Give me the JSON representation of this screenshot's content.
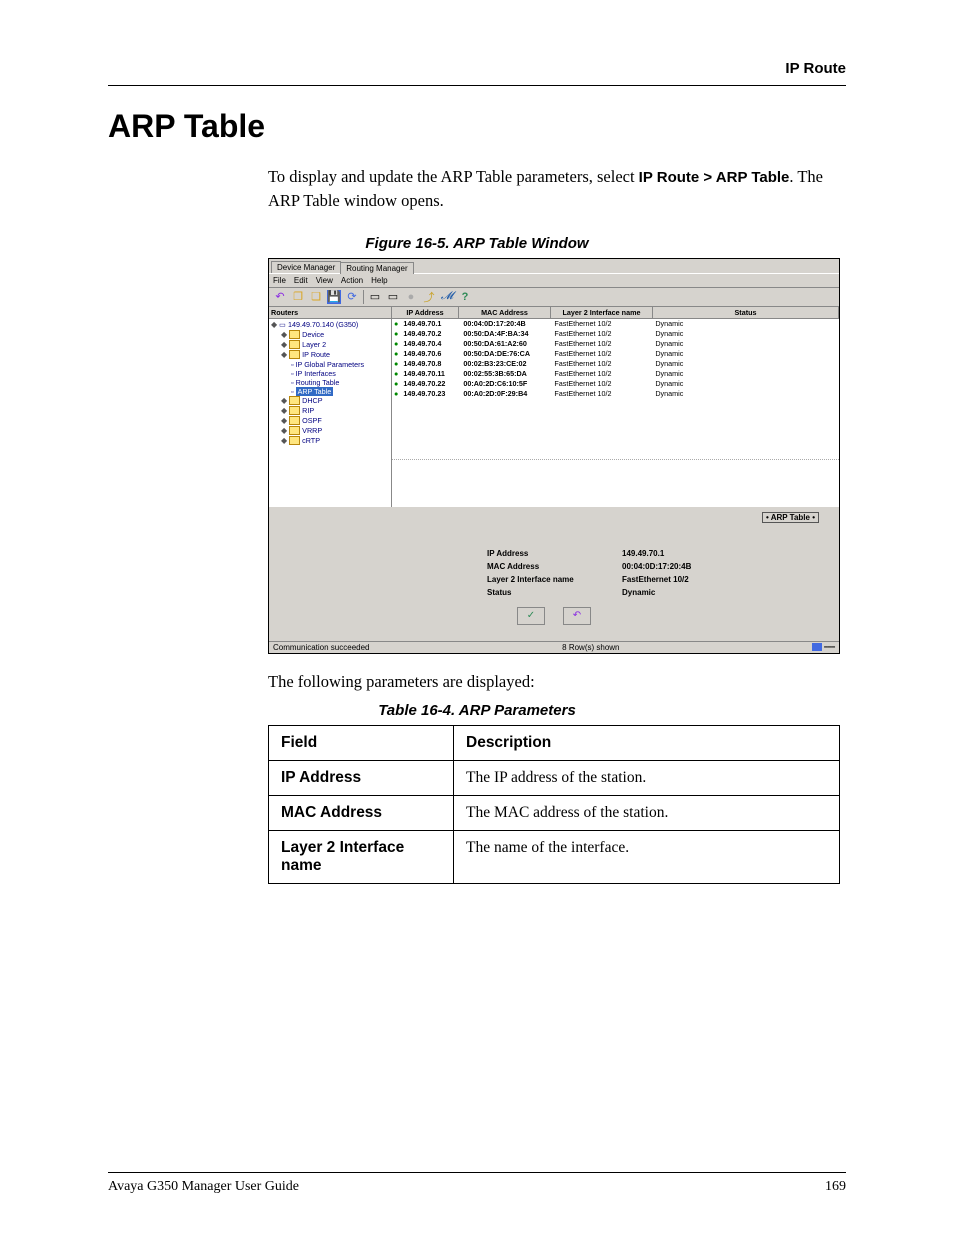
{
  "header": {
    "section": "IP Route"
  },
  "title": "ARP Table",
  "intro": {
    "prefix": "To display and update the ARP Table parameters, select ",
    "bold": "IP Route > ARP Table",
    "suffix": ". The ARP Table window opens."
  },
  "figure_caption": "Figure 16-5.  ARP Table Window",
  "screenshot": {
    "tabs": [
      "Device Manager",
      "Routing Manager"
    ],
    "menu": [
      "File",
      "Edit",
      "View",
      "Action",
      "Help"
    ],
    "tree_title": "Routers",
    "tree": {
      "root": "149.49.70.140 (G350)",
      "nodes": [
        "Device",
        "Layer 2",
        "IP Route"
      ],
      "iproute_children": [
        "IP Global Parameters",
        "IP Interfaces",
        "Routing Table",
        "ARP Table"
      ],
      "after": [
        "DHCP",
        "RIP",
        "OSPF",
        "VRRP",
        "cRTP"
      ]
    },
    "columns": [
      "IP Address",
      "MAC Address",
      "Layer 2 Interface name",
      "Status"
    ],
    "rows": [
      {
        "ip": "149.49.70.1",
        "mac": "00:04:0D:17:20:4B",
        "l2": "FastEthernet 10/2",
        "st": "Dynamic"
      },
      {
        "ip": "149.49.70.2",
        "mac": "00:50:DA:4F:BA:34",
        "l2": "FastEthernet 10/2",
        "st": "Dynamic"
      },
      {
        "ip": "149.49.70.4",
        "mac": "00:50:DA:61:A2:60",
        "l2": "FastEthernet 10/2",
        "st": "Dynamic"
      },
      {
        "ip": "149.49.70.6",
        "mac": "00:50:DA:DE:76:CA",
        "l2": "FastEthernet 10/2",
        "st": "Dynamic"
      },
      {
        "ip": "149.49.70.8",
        "mac": "00:02:B3:23:CE:02",
        "l2": "FastEthernet 10/2",
        "st": "Dynamic"
      },
      {
        "ip": "149.49.70.11",
        "mac": "00:02:55:3B:65:DA",
        "l2": "FastEthernet 10/2",
        "st": "Dynamic"
      },
      {
        "ip": "149.49.70.22",
        "mac": "00:A0:2D:C6:10:5F",
        "l2": "FastEthernet 10/2",
        "st": "Dynamic"
      },
      {
        "ip": "149.49.70.23",
        "mac": "00:A0:2D:0F:29:B4",
        "l2": "FastEthernet 10/2",
        "st": "Dynamic"
      }
    ],
    "form_title": "• ARP Table •",
    "form": [
      {
        "label": "IP Address",
        "value": "149.49.70.1"
      },
      {
        "label": "MAC Address",
        "value": "00:04:0D:17:20:4B"
      },
      {
        "label": "Layer 2 Interface name",
        "value": "FastEthernet 10/2"
      },
      {
        "label": "Status",
        "value": "Dynamic"
      }
    ],
    "status_left": "Communication succeeded",
    "status_mid": "8 Row(s) shown"
  },
  "body_text": "The following parameters are displayed:",
  "table_caption": "Table 16-4.  ARP Parameters",
  "param_table": {
    "headers": [
      "Field",
      "Description"
    ],
    "rows": [
      {
        "field": "IP Address",
        "desc": "The IP address of the station."
      },
      {
        "field": "MAC Address",
        "desc": "The MAC address of the station."
      },
      {
        "field": "Layer 2 Interface name",
        "desc": "The name of the interface."
      }
    ]
  },
  "footer": {
    "left": "Avaya G350 Manager User Guide",
    "right": "169"
  }
}
